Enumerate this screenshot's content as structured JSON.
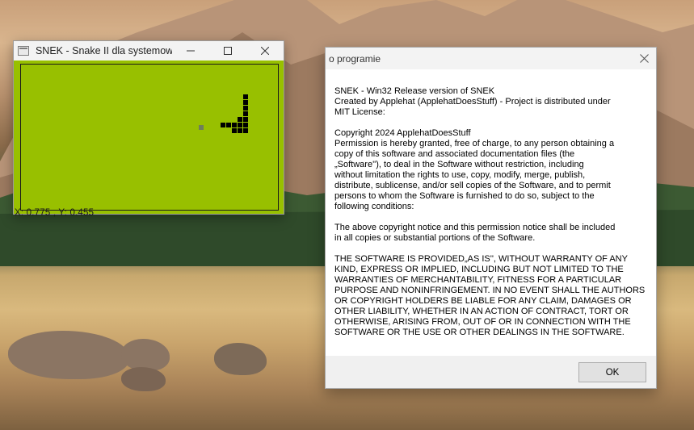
{
  "desktop": {
    "wallpaper": "mountain-lake"
  },
  "snek_window": {
    "title": "SNEK - Snake II dla systemow...",
    "minimize_icon": "minimize-icon",
    "maximize_icon": "maximize-icon",
    "close_icon": "close-icon",
    "board_color": "#98c000",
    "coords_text": "X: 0.775 , Y: 0.455"
  },
  "about_dialog": {
    "title": "o programie",
    "paragraphs": [
      "SNEK - Win32 Release version of SNEK\nCreated by Applehat (ApplehatDoesStuff) - Project is distributed under\nMIT License:",
      "Copyright 2024 ApplehatDoesStuff\nPermission is hereby granted, free of charge, to any person obtaining a\ncopy of this software and associated documentation files (the\n„Software''), to deal in the Software without restriction, including\nwithout limitation the rights to use, copy, modify, merge, publish,\ndistribute, sublicense, and/or sell copies of the Software, and to permit\npersons to whom the Software is furnished to do so, subject to the\nfollowing conditions:",
      "The above copyright notice and this permission notice shall be included\nin all copies or substantial portions of the Software.",
      "THE SOFTWARE IS PROVIDED„AS IS'', WITHOUT WARRANTY OF ANY\nKIND, EXPRESS OR IMPLIED, INCLUDING BUT NOT LIMITED TO THE\nWARRANTIES OF MERCHANTABILITY, FITNESS FOR A PARTICULAR\nPURPOSE AND NONINFRINGEMENT. IN NO EVENT SHALL THE AUTHORS\nOR COPYRIGHT HOLDERS BE LIABLE FOR ANY CLAIM, DAMAGES OR\nOTHER LIABILITY, WHETHER IN AN ACTION OF CONTRACT, TORT OR\nOTHERWISE, ARISING FROM, OUT OF OR IN CONNECTION WITH THE\nSOFTWARE OR THE USE OR OTHER DEALINGS IN THE SOFTWARE."
    ],
    "ok_label": "OK"
  }
}
